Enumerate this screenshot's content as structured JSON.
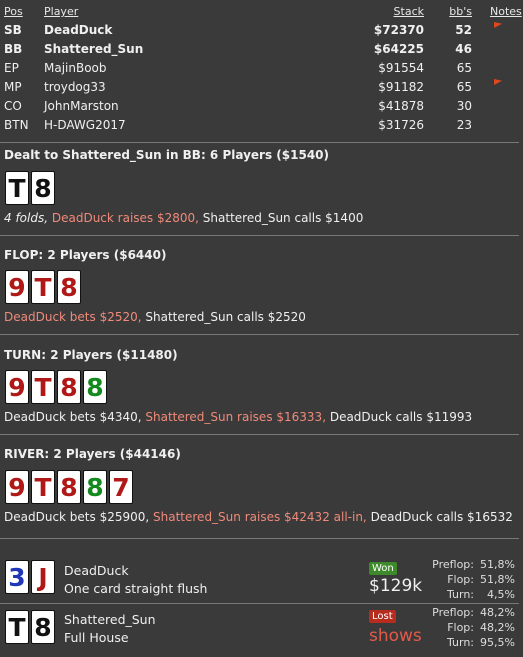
{
  "table": {
    "headers": {
      "pos": "Pos",
      "player": "Player",
      "stack": "Stack",
      "bbs": "bb's",
      "notes": "Notes"
    },
    "rows": [
      {
        "pos": "SB",
        "player": "DeadDuck",
        "stack": "$72370",
        "bbs": "52",
        "note": true,
        "bold": true
      },
      {
        "pos": "BB",
        "player": "Shattered_Sun",
        "stack": "$64225",
        "bbs": "46",
        "note": false,
        "bold": true
      },
      {
        "pos": "EP",
        "player": "MajinBoob",
        "stack": "$91554",
        "bbs": "65",
        "note": false,
        "bold": false
      },
      {
        "pos": "MP",
        "player": "troydog33",
        "stack": "$91182",
        "bbs": "65",
        "note": true,
        "bold": false
      },
      {
        "pos": "CO",
        "player": "JohnMarston",
        "stack": "$41878",
        "bbs": "30",
        "note": false,
        "bold": false
      },
      {
        "pos": "BTN",
        "player": "H-DAWG2017",
        "stack": "$31726",
        "bbs": "23",
        "note": false,
        "bold": false
      }
    ]
  },
  "preflop": {
    "title": "Dealt to Shattered_Sun in BB: 6 Players ($1540)",
    "cards": [
      {
        "rank": "T",
        "color": "black"
      },
      {
        "rank": "8",
        "color": "black"
      }
    ],
    "actions": [
      {
        "text": "4 folds, ",
        "style": "it"
      },
      {
        "text": "DeadDuck raises $2800, ",
        "style": "hi"
      },
      {
        "text": "Shattered_Sun calls $1400",
        "style": "lo"
      }
    ]
  },
  "flop": {
    "title": "FLOP: 2 Players ($6440)",
    "cards": [
      {
        "rank": "9",
        "color": "red"
      },
      {
        "rank": "T",
        "color": "red"
      },
      {
        "rank": "8",
        "color": "red"
      }
    ],
    "actions": [
      {
        "text": "DeadDuck bets $2520, ",
        "style": "hi"
      },
      {
        "text": "Shattered_Sun calls $2520",
        "style": "lo"
      }
    ]
  },
  "turn": {
    "title": "TURN: 2 Players ($11480)",
    "cards": [
      {
        "rank": "9",
        "color": "red"
      },
      {
        "rank": "T",
        "color": "red"
      },
      {
        "rank": "8",
        "color": "red"
      },
      {
        "rank": "8",
        "color": "green"
      }
    ],
    "actions": [
      {
        "text": "DeadDuck bets $4340, ",
        "style": "lo"
      },
      {
        "text": "Shattered_Sun raises $16333, ",
        "style": "hi"
      },
      {
        "text": "DeadDuck calls $11993",
        "style": "lo"
      }
    ]
  },
  "river": {
    "title": "RIVER: 2 Players ($44146)",
    "cards": [
      {
        "rank": "9",
        "color": "red"
      },
      {
        "rank": "T",
        "color": "red"
      },
      {
        "rank": "8",
        "color": "red"
      },
      {
        "rank": "8",
        "color": "green"
      },
      {
        "rank": "7",
        "color": "red"
      }
    ],
    "actions": [
      {
        "text": "DeadDuck bets $25900, ",
        "style": "lo"
      },
      {
        "text": "Shattered_Sun raises $42432 all-in, ",
        "style": "hi"
      },
      {
        "text": "DeadDuck calls $16532",
        "style": "lo"
      }
    ]
  },
  "showdown": [
    {
      "cards": [
        {
          "rank": "3",
          "color": "blue"
        },
        {
          "rank": "J",
          "color": "red"
        }
      ],
      "name": "DeadDuck",
      "hand": "One card straight flush",
      "badge": "Won",
      "badge_type": "won",
      "amount": "$129k",
      "equity": [
        {
          "label": "Preflop:",
          "value": "51,8%"
        },
        {
          "label": "Flop:",
          "value": "51,8%"
        },
        {
          "label": "Turn:",
          "value": "4,5%"
        }
      ]
    },
    {
      "cards": [
        {
          "rank": "T",
          "color": "black"
        },
        {
          "rank": "8",
          "color": "black"
        }
      ],
      "name": "Shattered_Sun",
      "hand": "Full House",
      "badge": "Lost",
      "badge_type": "lost",
      "amount": "shows",
      "equity": [
        {
          "label": "Preflop:",
          "value": "48,2%"
        },
        {
          "label": "Flop:",
          "value": "48,2%"
        },
        {
          "label": "Turn:",
          "value": "95,5%"
        }
      ]
    }
  ]
}
